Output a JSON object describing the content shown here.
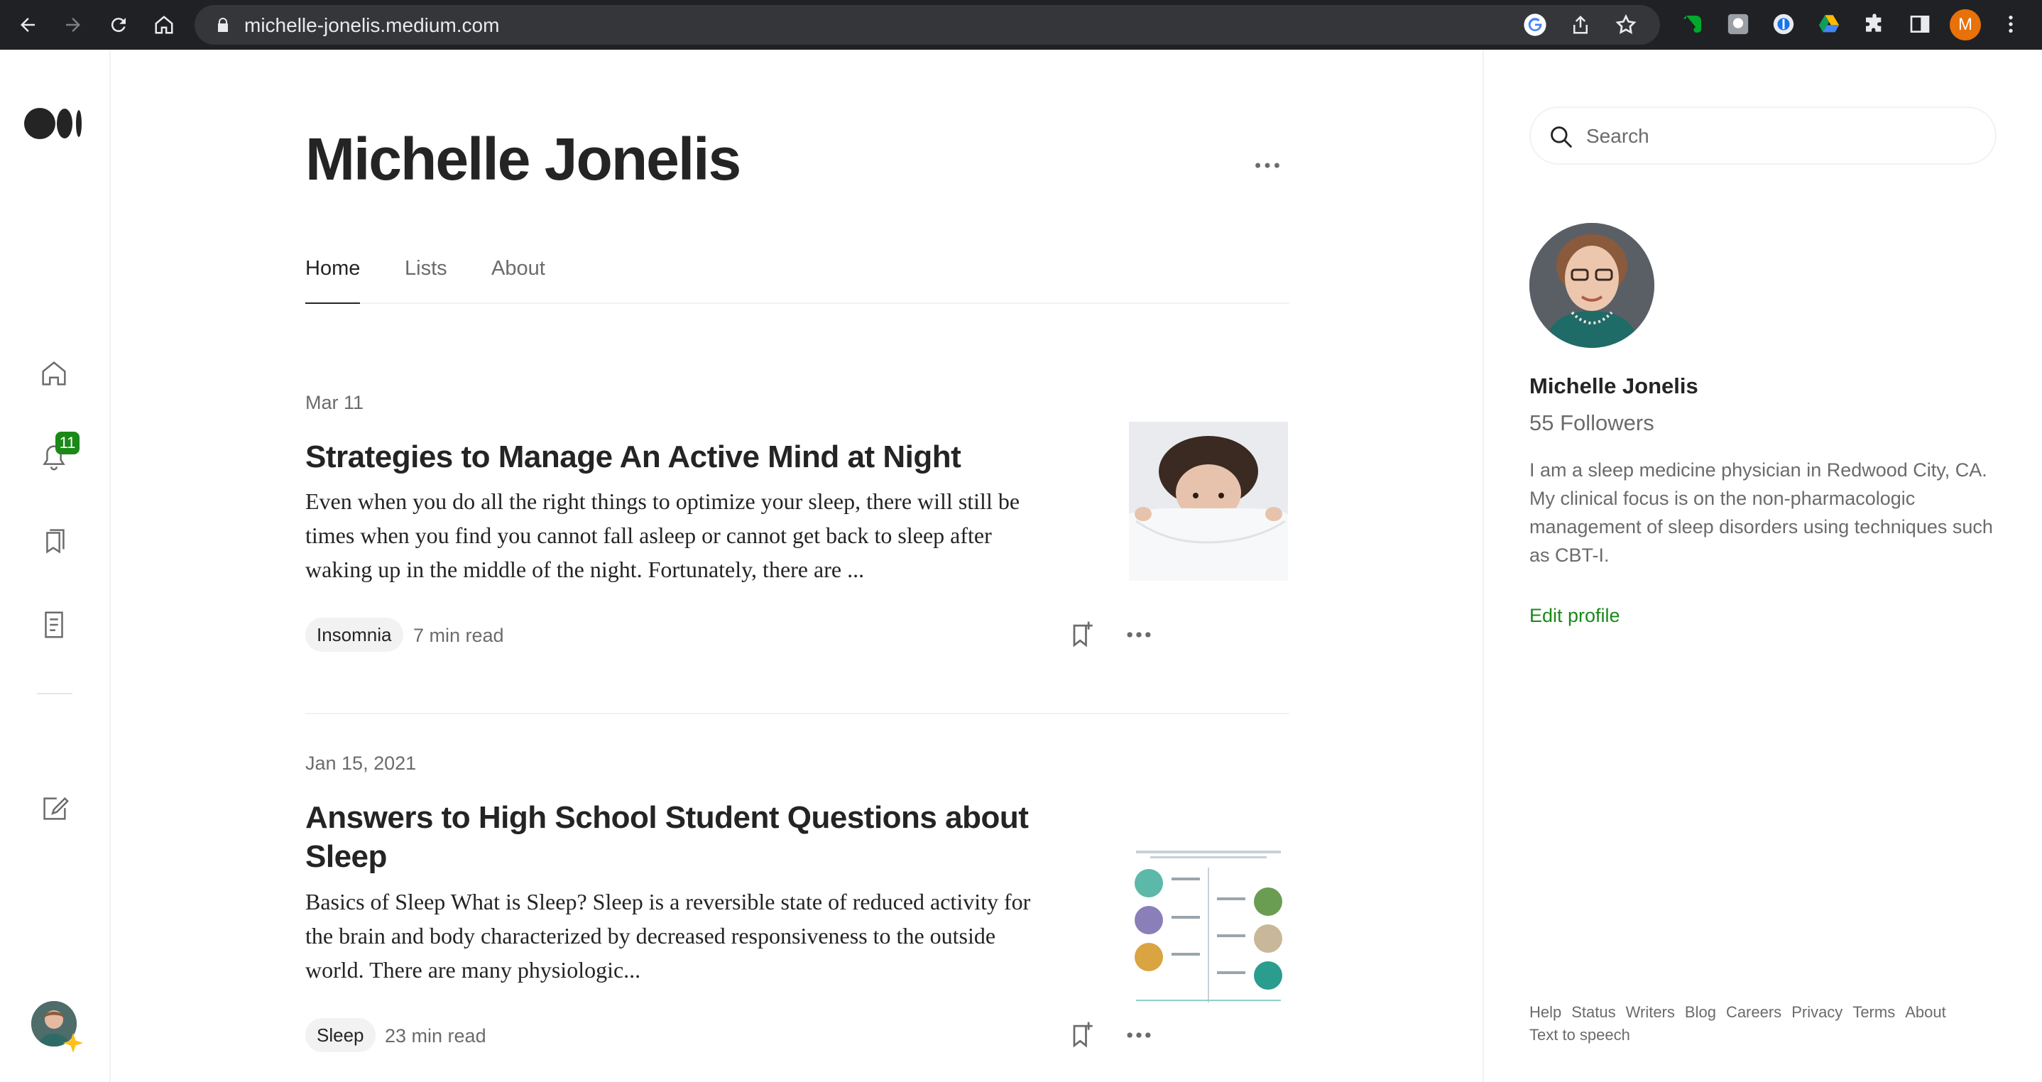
{
  "browser": {
    "url": "michelle-jonelis.medium.com",
    "profile_initial": "M"
  },
  "rail": {
    "notification_count": "11"
  },
  "profile": {
    "name": "Michelle Jonelis",
    "tabs": [
      {
        "label": "Home",
        "active": true
      },
      {
        "label": "Lists",
        "active": false
      },
      {
        "label": "About",
        "active": false
      }
    ]
  },
  "posts": [
    {
      "date": "Mar 11",
      "title": "Strategies to Manage An Active Mind at Night",
      "excerpt": "Even when you do all the right things to optimize your sleep, there will still be times when you find you cannot fall asleep or cannot get back to sleep after waking up in the middle of the night. Fortunately, there are ...",
      "tag": "Insomnia",
      "read_time": "7 min read"
    },
    {
      "date": "Jan 15, 2021",
      "title": "Answers to High School Student Questions about Sleep",
      "excerpt": "Basics of Sleep What is Sleep? Sleep is a reversible state of reduced activity for the brain and body characterized by decreased responsiveness to the outside world. There are many physiologic...",
      "tag": "Sleep",
      "read_time": "23 min read"
    }
  ],
  "sidebar": {
    "search_placeholder": "Search",
    "name": "Michelle Jonelis",
    "followers": "55 Followers",
    "bio": "I am a sleep medicine physician in Redwood City, CA. My clinical focus is on the non-pharmacologic management of sleep disorders using techniques such as CBT-I.",
    "edit_profile": "Edit profile",
    "footer": [
      "Help",
      "Status",
      "Writers",
      "Blog",
      "Careers",
      "Privacy",
      "Terms",
      "About",
      "Text to speech"
    ]
  },
  "colors": {
    "accent_green": "#1a8917",
    "chrome_bg": "#202124"
  }
}
